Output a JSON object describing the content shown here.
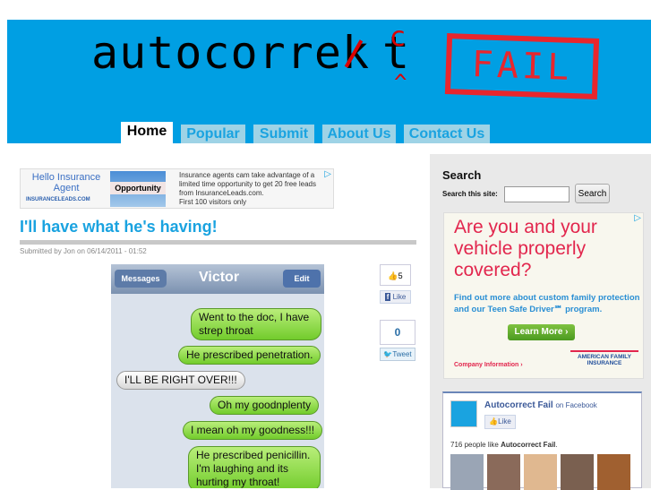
{
  "header": {
    "logo_text": "autocorre",
    "logo_strike": "k",
    "logo_insert": "c",
    "logo_end": "t",
    "stamp": "FAIL"
  },
  "nav": [
    {
      "label": "Home"
    },
    {
      "label": "Popular"
    },
    {
      "label": "Submit"
    },
    {
      "label": "About Us"
    },
    {
      "label": "Contact Us"
    }
  ],
  "ad_top": {
    "title": "Hello Insurance Agent",
    "brand": "INSURANCELEADS.COM",
    "image_text": "Opportunity",
    "body": "Insurance agents cam take advantage of a limited time opportunity to get 20 free leads from InsuranceLeads.com.",
    "line4": "First 100 visitors only"
  },
  "post": {
    "title": "I'll have what he's having!",
    "meta": "Submitted by Jon on 06/14/2011 - 01:52",
    "phone": {
      "back": "Messages",
      "contact": "Victor",
      "edit": "Edit",
      "messages": [
        {
          "text": "Went to the doc, I have strep throat"
        },
        {
          "text": "He prescribed penetration."
        },
        {
          "text": "I'LL BE RIGHT OVER!!!"
        },
        {
          "text": "Oh my goodnplenty"
        },
        {
          "text": "I mean oh my goodness!!!"
        },
        {
          "text": "He prescribed penicillin. I'm laughing and its hurting my throat!"
        }
      ]
    },
    "like_count": "5",
    "like_label": "Like",
    "tweet_count": "0",
    "tweet_label": "Tweet"
  },
  "sidebar": {
    "search_heading": "Search",
    "search_label": "Search this site:",
    "search_value": "",
    "search_button": "Search",
    "ad": {
      "headline": "Are you and your vehicle properly covered?",
      "body": "Find out more about custom family protection and our Teen Safe Driver℠ program.",
      "cta": "Learn More ›",
      "link": "Company Information ›",
      "brand": "AMERICAN FAMILY INSURANCE"
    },
    "facebook": {
      "page": "Autocorrect Fail",
      "on": "on Facebook",
      "like": "Like",
      "count_text": "716 people like",
      "count_page": "Autocorrect Fail"
    }
  },
  "colors": {
    "header": "#009fe3",
    "accent": "#1aa3e0",
    "stamp": "#e8262d"
  }
}
